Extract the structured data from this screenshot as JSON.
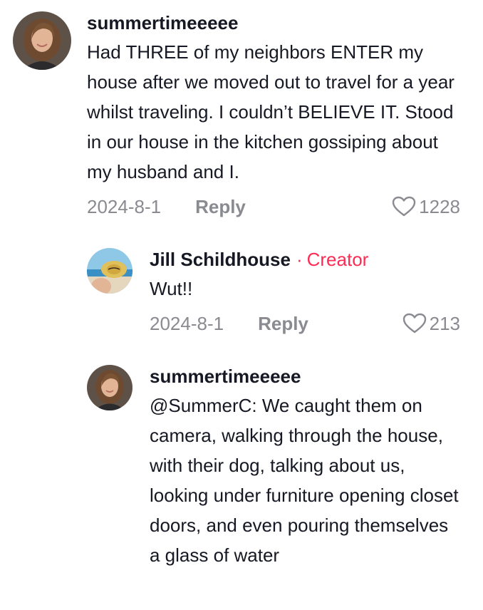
{
  "comments": [
    {
      "username": "summertimeeeee",
      "text": "Had THREE of my neighbors ENTER my house after we moved out to travel for a year whilst traveling. I couldn’t BELIEVE IT. Stood in our house in the kitchen gossiping about my husband and I.",
      "date": "2024-8-1",
      "reply_label": "Reply",
      "likes": "1228",
      "avatar_icon": "user-avatar"
    },
    {
      "username": "Jill Schildhouse",
      "separator": "·",
      "badge": "Creator",
      "text": "Wut!!",
      "date": "2024-8-1",
      "reply_label": "Reply",
      "likes": "213",
      "avatar_icon": "creator-avatar"
    },
    {
      "username": "summertimeeeee",
      "text": "@SummerC: We caught them on camera, walking through the house, with their dog, talking about us, looking under furniture opening closet doors, and even pouring themselves a glass of water",
      "avatar_icon": "user-avatar"
    }
  ],
  "colors": {
    "text": "#161823",
    "muted": "#8a8b91",
    "accent": "#fe2c55"
  }
}
